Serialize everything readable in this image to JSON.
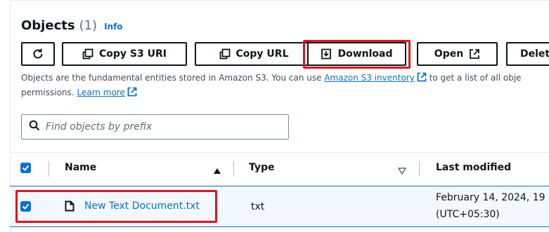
{
  "header": {
    "title": "Objects",
    "count": "(1)",
    "info_label": "Info"
  },
  "toolbar": {
    "copy_s3_uri_label": "Copy S3 URI",
    "copy_url_label": "Copy URL",
    "download_label": "Download",
    "open_label": "Open",
    "delete_label": "Delet"
  },
  "description": {
    "text_before": "Objects are the fundamental entities stored in Amazon S3. You can use ",
    "inventory_link": "Amazon S3 inventory",
    "text_after": " to get a list of all obje",
    "line2_text": "permissions. ",
    "learn_more_link": "Learn more"
  },
  "search": {
    "placeholder": "Find objects by prefix"
  },
  "table": {
    "columns": {
      "name": "Name",
      "type": "Type",
      "last_modified": "Last modified"
    },
    "rows": [
      {
        "name": "New Text Document.txt",
        "type": "txt",
        "last_modified_line1": "February 14, 2024, 19",
        "last_modified_line2": "(UTC+05:30)",
        "selected": true
      }
    ]
  },
  "colors": {
    "accent": "#0972d3",
    "highlight": "#e0151b",
    "text": "#0f141a",
    "selected_row_bg": "#f2f8fd"
  },
  "icons": [
    "refresh-icon",
    "copy-icon",
    "download-icon",
    "external-link-icon",
    "search-icon",
    "file-icon",
    "sort-ascending-icon",
    "sort-descending-icon",
    "checkbox-checked-icon"
  ]
}
